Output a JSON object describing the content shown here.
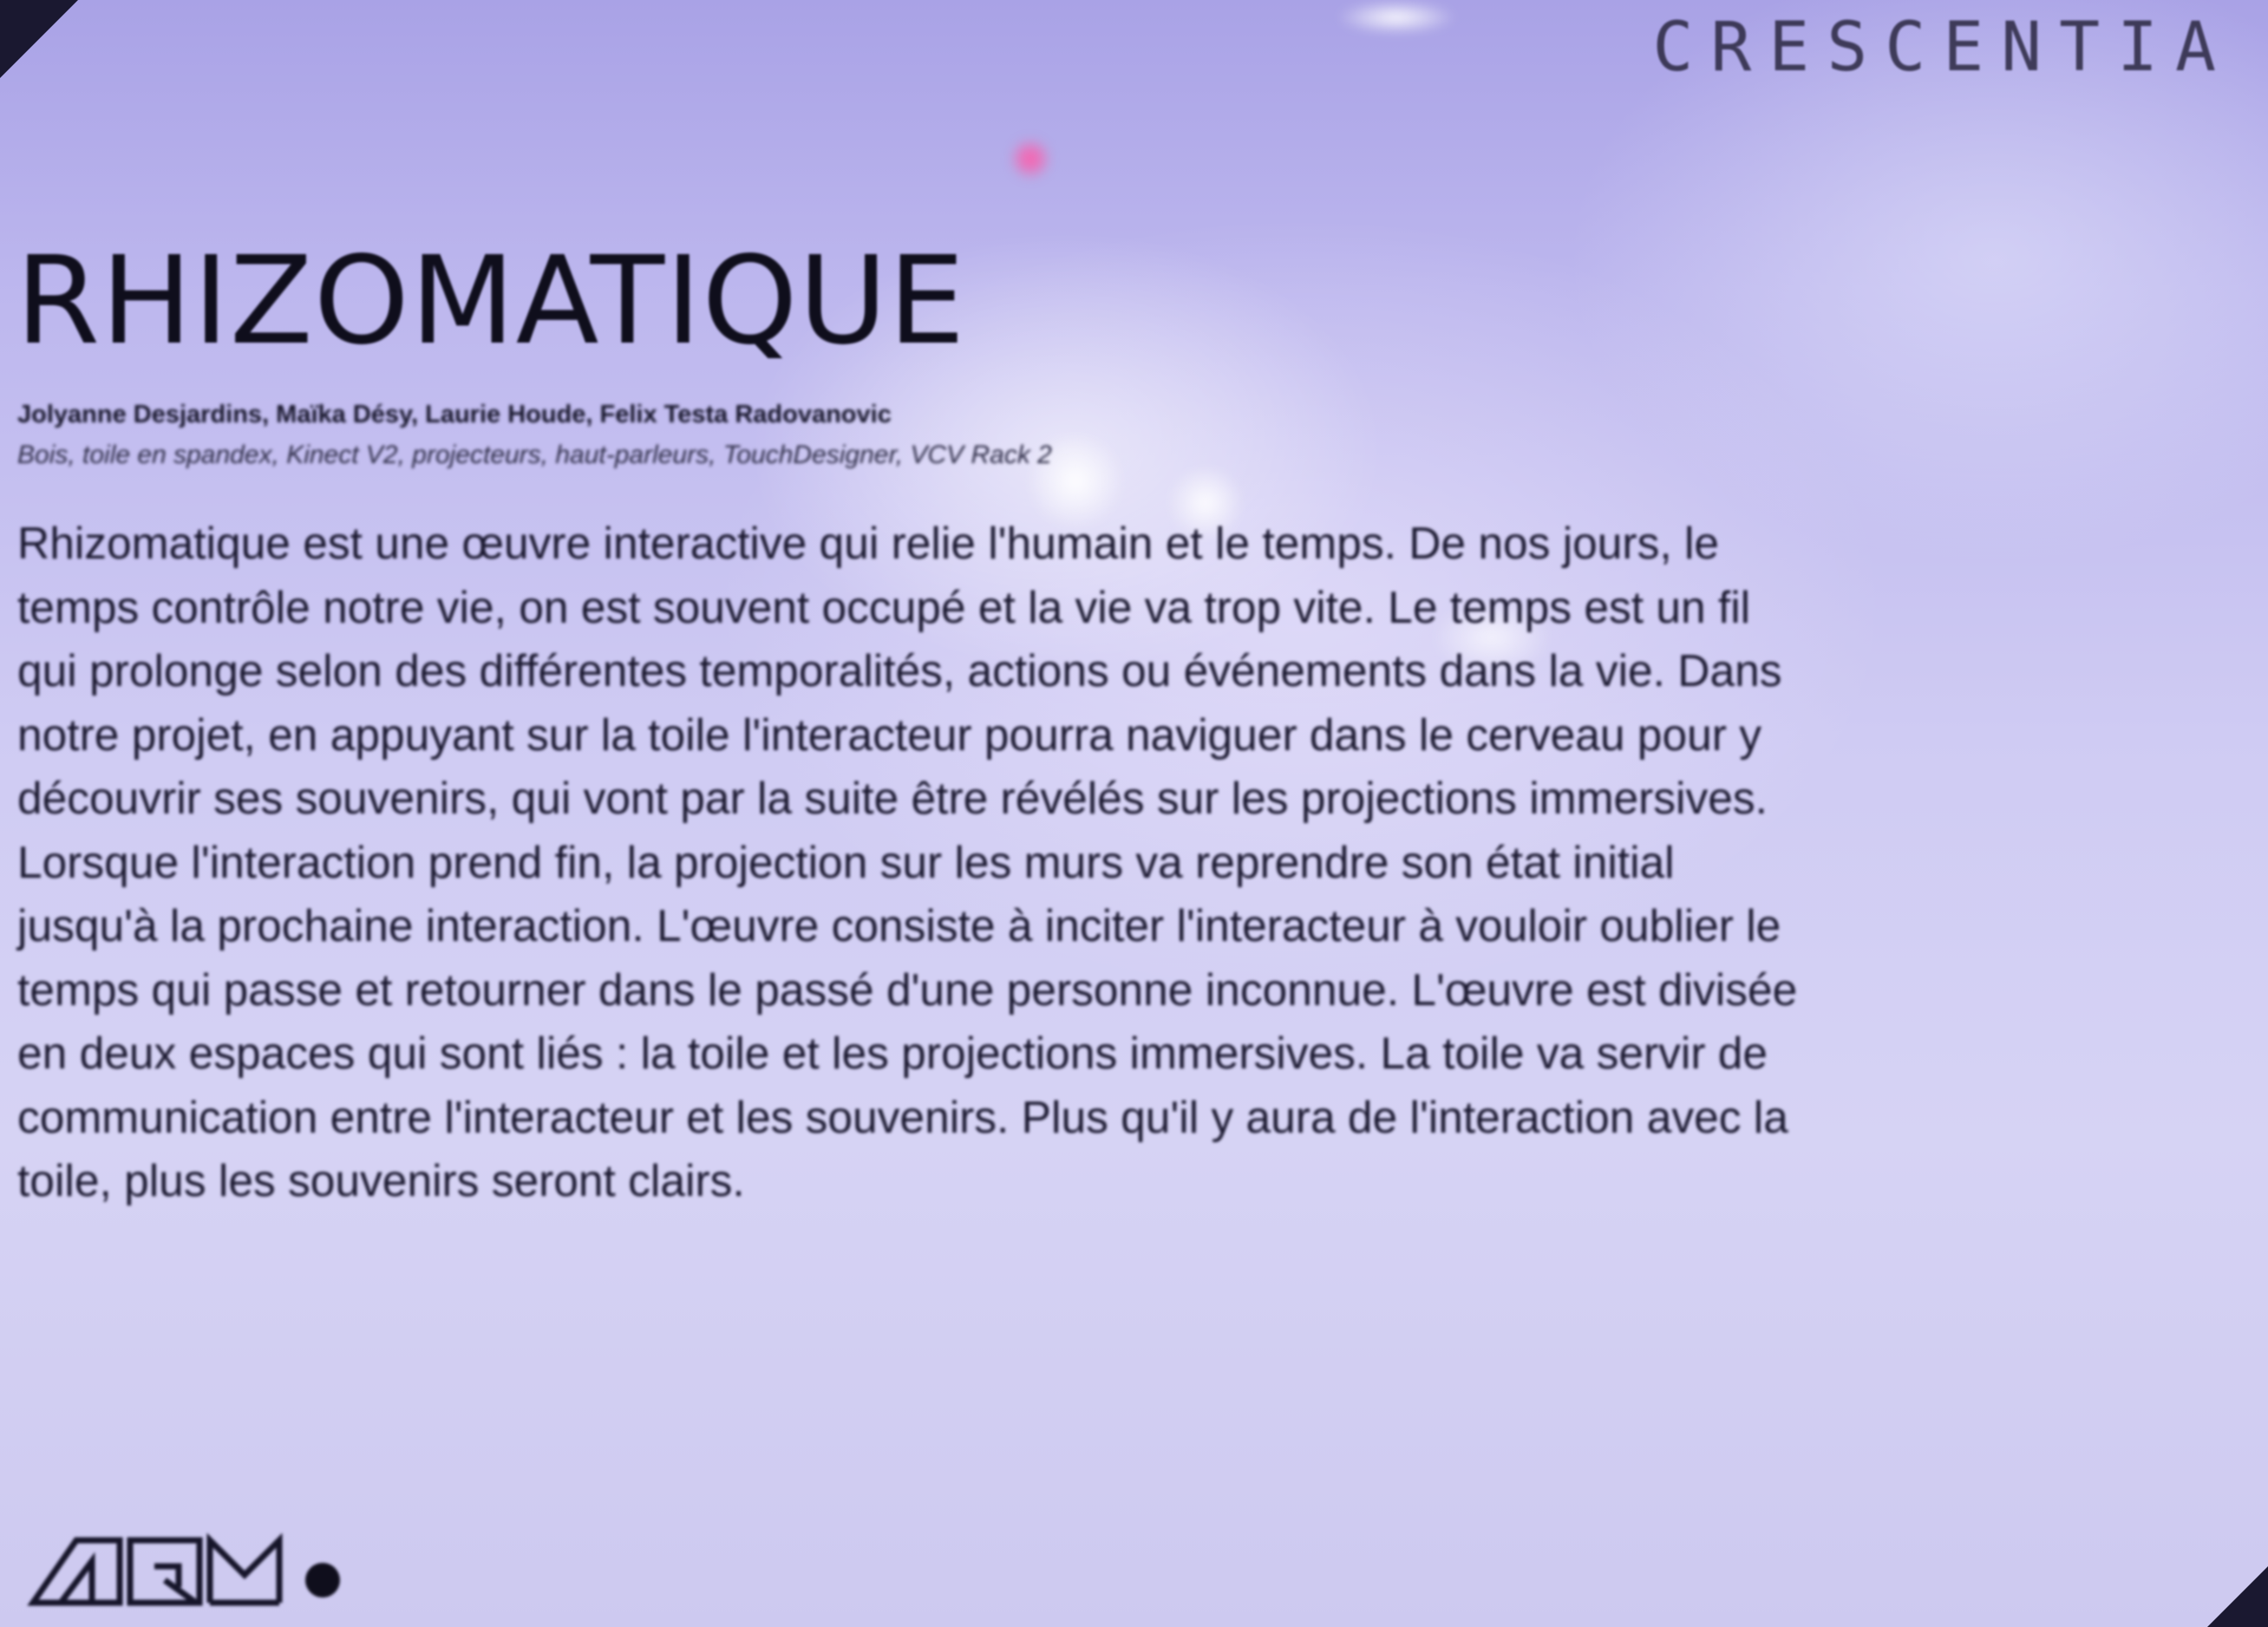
{
  "brand": "CRESCENTIA",
  "title": "RHIZOMATIQUE",
  "authors": "Jolyanne Desjardins, Maïka Désy, Laurie Houde, Felix Testa Radovanovic",
  "materials": "Bois, toile en spandex, Kinect V2, projecteurs, haut-parleurs, TouchDesigner, VCV Rack 2",
  "description_lines": [
    "Rhizomatique est une œuvre interactive qui relie l'humain et le temps. De nos jours, le",
    "temps contrôle notre vie, on est souvent occupé et la vie va trop vite. Le temps est un fil",
    "qui prolonge selon des différentes temporalités, actions ou événements dans la vie. Dans",
    "notre projet, en appuyant sur la toile l'interacteur pourra naviguer dans le cerveau pour y",
    "découvrir ses souvenirs, qui vont par la suite être révélés sur les projections immersives.",
    "Lorsque l'interaction prend fin, la projection sur les murs va reprendre son état initial",
    "jusqu'à la prochaine interaction. L'œuvre consiste à inciter l'interacteur à vouloir oublier le",
    "temps qui passe et retourner dans le passé d'une personne inconnue. L'œuvre est divisée",
    "en deux espaces qui sont liés : la toile et les projections immersives. La toile va servir de",
    "communication entre l'interacteur et les souvenirs. Plus qu'il y aura de l'interaction avec la",
    "toile, plus les souvenirs seront clairs."
  ],
  "logo": "AQM",
  "colors": {
    "panel_background": "#cfcbf3",
    "text": "#1b1930",
    "glare_pink": "#ff5aa8"
  }
}
